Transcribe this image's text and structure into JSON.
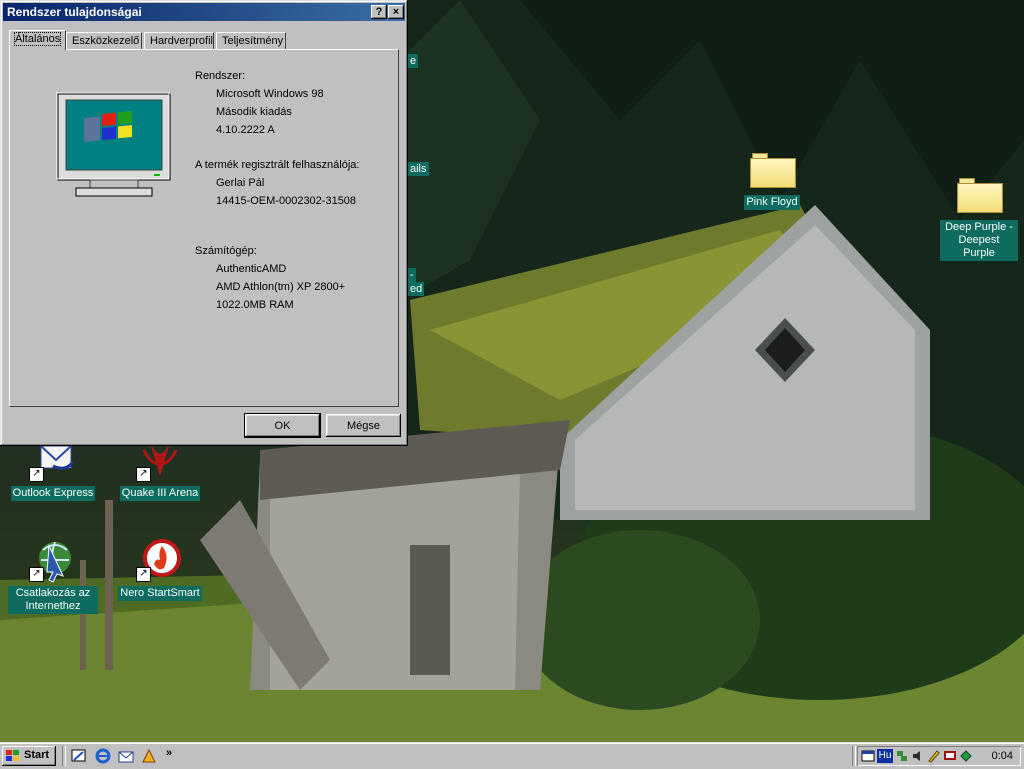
{
  "dialog": {
    "title": "Rendszer tulajdonságai",
    "help_button": "?",
    "close_button": "×",
    "tabs": [
      {
        "label": "Általános",
        "active": true
      },
      {
        "label": "Eszközkezelő",
        "active": false
      },
      {
        "label": "Hardverprofil",
        "active": false
      },
      {
        "label": "Teljesítmény",
        "active": false
      }
    ],
    "system": {
      "heading": "Rendszer:",
      "lines": [
        "Microsoft Windows 98",
        "Második kiadás",
        "4.10.2222 A"
      ]
    },
    "registered": {
      "heading": "A termék regisztrált felhasználója:",
      "lines": [
        "Gerlai Pál",
        "14415-OEM-0002302-31508"
      ]
    },
    "computer": {
      "heading": "Számítógép:",
      "lines": [
        "AuthenticAMD",
        "AMD Athlon(tm) XP 2800+",
        "1022.0MB RAM"
      ]
    },
    "ok_label": "OK",
    "cancel_label": "Mégse"
  },
  "desktop": {
    "icons": [
      {
        "label": "Pink Floyd",
        "icon": "folder-icon"
      },
      {
        "label": "Deep Purple - Deepest Purple",
        "icon": "folder-icon"
      },
      {
        "label": "Outlook Express",
        "icon": "outlook-express-icon"
      },
      {
        "label": "Quake III Arena",
        "icon": "quake-icon"
      },
      {
        "label": "Csatlakozás az Internethez",
        "icon": "connect-internet-icon"
      },
      {
        "label": "Nero StartSmart",
        "icon": "nero-icon"
      }
    ],
    "partial_labels": [
      "e",
      "ails",
      "-",
      "ed"
    ]
  },
  "taskbar": {
    "start_label": "Start",
    "quicklaunch_more": "»",
    "tray_language": "Hu",
    "clock": "0:04"
  },
  "colors": {
    "titlebar": "#0a246a",
    "face": "#c0c0c0",
    "icon_label_bg": "#0e6b5f"
  }
}
